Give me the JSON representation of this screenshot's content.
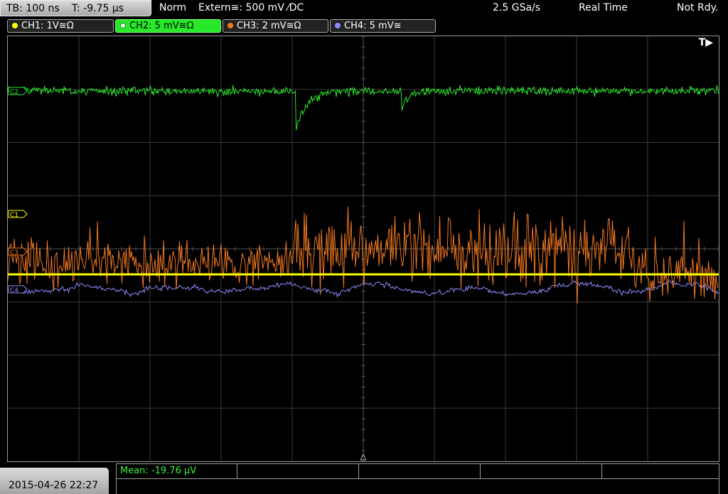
{
  "topbar": {
    "timebase": "TB: 100 ns",
    "trigger_time": "T: -9.75 µs",
    "mode": "Norm",
    "trigger_source": "Extern≅: 500 mV ⁄DC",
    "sample_rate": "2.5 GSa/s",
    "acq_mode": "Real Time",
    "trigger_status": "Not Rdy."
  },
  "channels": [
    {
      "label": "CH1: 1V≅Ω",
      "color": "#ffff00",
      "marker": "C1"
    },
    {
      "label": "CH2: 5 mV≅Ω",
      "color": "#28e82a",
      "marker": "C2"
    },
    {
      "label": "CH3: 2 mV≅Ω",
      "color": "#f07820",
      "marker": "C3"
    },
    {
      "label": "CH4: 5 mV≅",
      "color": "#8c8cff",
      "marker": "C4"
    }
  ],
  "screen": {
    "trigger_flag": "T▶",
    "grid_divisions": {
      "x": 10,
      "y": 8
    }
  },
  "measurement": {
    "mean": "Mean: -19.76 µV"
  },
  "footer": {
    "datetime": "2015-04-26 22:27"
  }
}
